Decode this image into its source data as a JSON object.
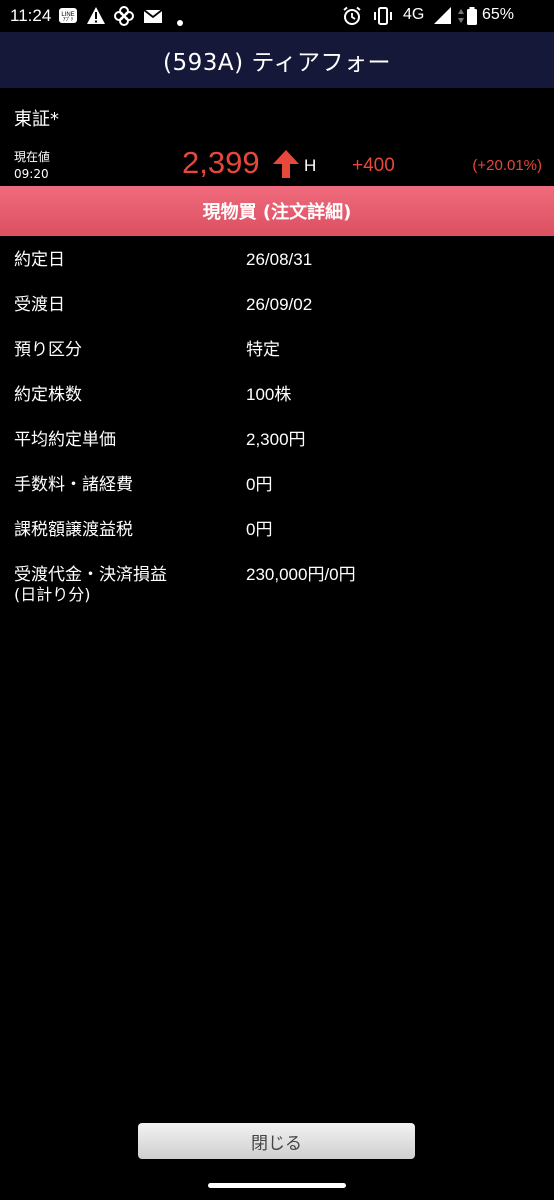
{
  "status_bar": {
    "time": "11:24",
    "network": "4G",
    "battery": "65%"
  },
  "header": {
    "title": "(593A) ティアフォー"
  },
  "quote": {
    "market": "東証*",
    "price_label": "現在値",
    "price_time": "09:20",
    "price": "2,399",
    "price_flag": "H",
    "change": "+400",
    "change_pct": "(+20.01%)",
    "up_color": "#e8473b"
  },
  "banner": {
    "label": "現物買 (注文詳細)",
    "color": "#e55c6d"
  },
  "details": [
    {
      "label": "約定日",
      "value": "26/08/31"
    },
    {
      "label": "受渡日",
      "value": "26/09/02"
    },
    {
      "label": "預り区分",
      "value": "特定"
    },
    {
      "label": "約定株数",
      "value": "100株"
    },
    {
      "label": "平均約定単価",
      "value": "2,300円"
    },
    {
      "label": "手数料・諸経費",
      "value": "0円"
    },
    {
      "label": "課税額譲渡益税",
      "value": "0円"
    },
    {
      "label": "受渡代金・決済損益",
      "label_sub": "(日計り分)",
      "value": "230,000円/0円"
    }
  ],
  "footer": {
    "close_label": "閉じる"
  },
  "icons": [
    "line-icon",
    "warning-icon",
    "pinwheel-icon",
    "mail-icon",
    "dot-icon",
    "alarm-icon",
    "vibrate-icon",
    "signal-icon",
    "battery-icon",
    "up-arrow-icon"
  ]
}
